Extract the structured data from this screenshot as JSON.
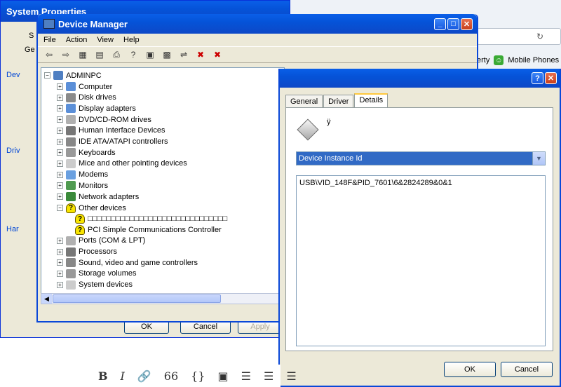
{
  "browser": {
    "bookmarks": [
      "erty",
      "Mobile Phones"
    ]
  },
  "system_properties": {
    "title": "System Properties",
    "tabs": [
      "S",
      "Ge"
    ],
    "groups": [
      "Dev",
      "Driv",
      "Har"
    ],
    "buttons": [
      "OK",
      "Cancel",
      "Apply"
    ]
  },
  "device_manager": {
    "title": "Device Manager",
    "menu": [
      "File",
      "Action",
      "View",
      "Help"
    ],
    "tree": {
      "root": "ADMINPC",
      "items": [
        "Computer",
        "Disk drives",
        "Display adapters",
        "DVD/CD-ROM drives",
        "Human Interface Devices",
        "IDE ATA/ATAPI controllers",
        "Keyboards",
        "Mice and other pointing devices",
        "Modems",
        "Monitors",
        "Network adapters",
        "Other devices"
      ],
      "other_children": [
        "□□□□□□□□□□□□□□□□□□□□□□□□□□□□□□",
        "PCI Simple Communications Controller"
      ],
      "items_after": [
        "Ports (COM & LPT)",
        "Processors",
        "Sound, video and game controllers",
        "Storage volumes",
        "System devices"
      ]
    }
  },
  "properties_dialog": {
    "tabs": [
      "General",
      "Driver",
      "Details"
    ],
    "device_name": "ÿ",
    "property_select": "Device Instance Id",
    "value": "USB\\VID_148F&PID_7601\\6&2824289&0&1",
    "ok": "OK",
    "cancel": "Cancel",
    "help_glyph": "?",
    "close_glyph": "✕"
  },
  "editor_toolbar": [
    "B",
    "I",
    "🔗",
    "66",
    "{}",
    "▣",
    "☰",
    "☰",
    "☰"
  ]
}
